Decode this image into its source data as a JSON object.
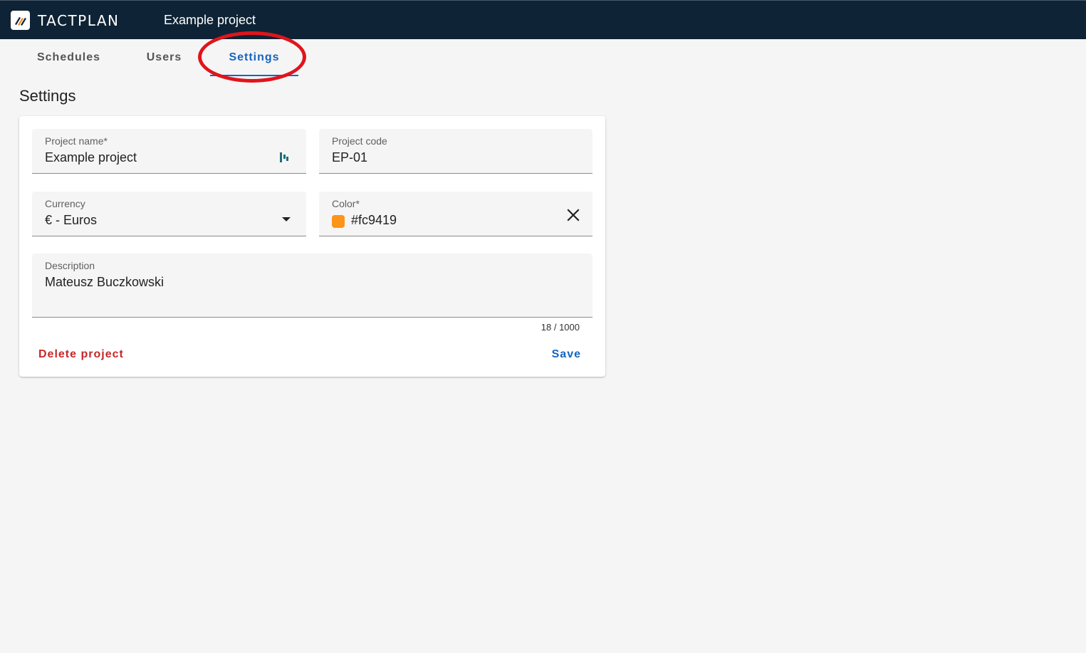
{
  "app": {
    "logo_text": "TACTPLAN",
    "project_title": "Example project"
  },
  "tabs": [
    {
      "label": "Schedules",
      "active": false
    },
    {
      "label": "Users",
      "active": false
    },
    {
      "label": "Settings",
      "active": true
    }
  ],
  "page": {
    "heading": "Settings"
  },
  "form": {
    "project_name": {
      "label": "Project name*",
      "value": "Example project"
    },
    "project_code": {
      "label": "Project code",
      "value": "EP-01"
    },
    "currency": {
      "label": "Currency",
      "value": "€ - Euros"
    },
    "color": {
      "label": "Color*",
      "value": "#fc9419",
      "swatch": "#fc9419"
    },
    "description": {
      "label": "Description",
      "value": "Mateusz Buczkowski",
      "counter": "18 / 1000"
    }
  },
  "actions": {
    "delete_label": "Delete project",
    "save_label": "Save"
  },
  "colors": {
    "topbar": "#0e2335",
    "accent": "#1565c0",
    "danger": "#c62828",
    "annotation": "#e0141b"
  }
}
